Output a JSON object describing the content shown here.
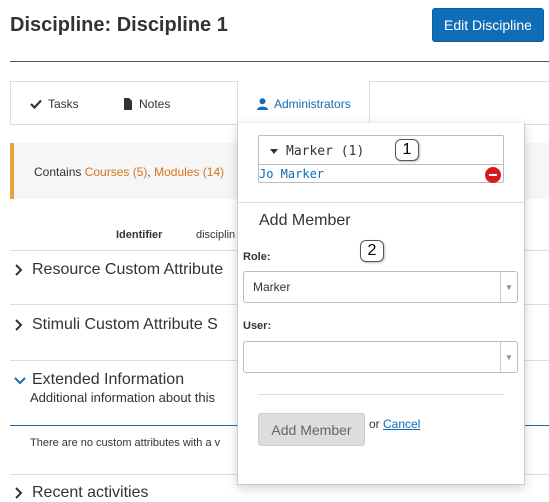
{
  "header": {
    "title": "Discipline: Discipline 1",
    "edit_button": "Edit Discipline"
  },
  "tabs": [
    {
      "label": "Tasks",
      "icon": "check-icon"
    },
    {
      "label": "Notes",
      "icon": "document-icon"
    },
    {
      "label": "Administrators",
      "icon": "user-icon",
      "active": true
    }
  ],
  "contains": {
    "prefix": "Contains",
    "courses": "Courses (5)",
    "separator": ",",
    "modules": "Modules (14)"
  },
  "identifier": {
    "label": "Identifier",
    "value": "disciplin"
  },
  "sections": {
    "resource": "Resource Custom Attribute",
    "stimuli": "Stimuli Custom Attribute S",
    "extended": "Extended Information",
    "extended_sub": "Additional information about this",
    "no_attrs": "There are no custom attributes with a v",
    "recent": "Recent activities"
  },
  "popover": {
    "group_label": "Marker (1)",
    "member": "Jo Marker",
    "add_member_title": "Add Member",
    "role_label": "Role:",
    "role_value": "Marker",
    "user_label": "User:",
    "user_value": "",
    "add_button": "Add Member",
    "or_text": "or",
    "cancel_link": "Cancel"
  },
  "callouts": [
    "1",
    "2"
  ],
  "colors": {
    "primary": "#0f6cb6",
    "warning_border": "#e8a33d",
    "link_orange": "#d6741a",
    "danger": "#d9181f"
  }
}
